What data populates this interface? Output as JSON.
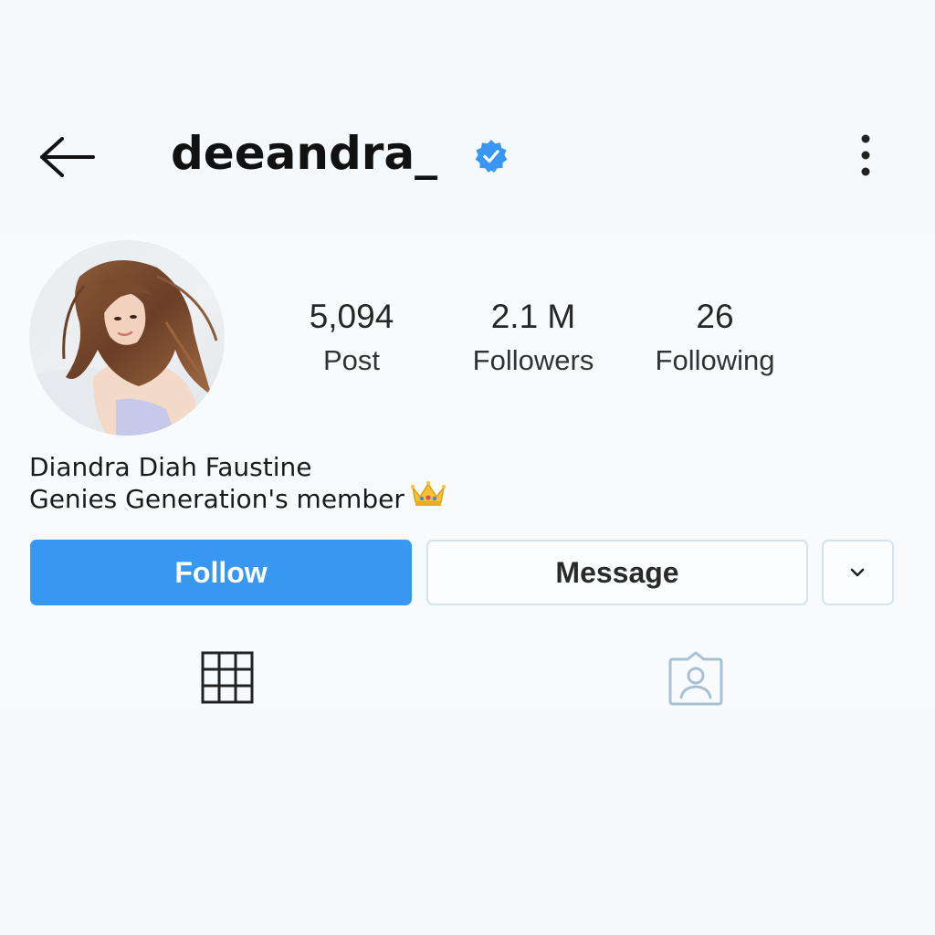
{
  "header": {
    "username": "deeandra_",
    "back_icon": "arrow-left-icon",
    "verified_icon": "verified-badge-icon",
    "more_icon": "vertical-ellipsis-icon"
  },
  "profile": {
    "avatar_icon": "profile-photo",
    "stats": [
      {
        "value": "5,094",
        "label": "Post"
      },
      {
        "value": "2.1 M",
        "label": "Followers"
      },
      {
        "value": "26",
        "label": "Following"
      }
    ],
    "bio": {
      "name": "Diandra Diah Faustine",
      "text": "Genies Generation's member",
      "emoji": "crown"
    }
  },
  "actions": {
    "follow_label": "Follow",
    "message_label": "Message",
    "more_icon": "chevron-down-icon"
  },
  "tabs": [
    {
      "name": "grid",
      "icon": "grid-icon"
    },
    {
      "name": "tagged",
      "icon": "tagged-person-icon"
    }
  ],
  "colors": {
    "accent": "#3897f0",
    "verified": "#3897f0",
    "background": "#f6f9fb"
  }
}
